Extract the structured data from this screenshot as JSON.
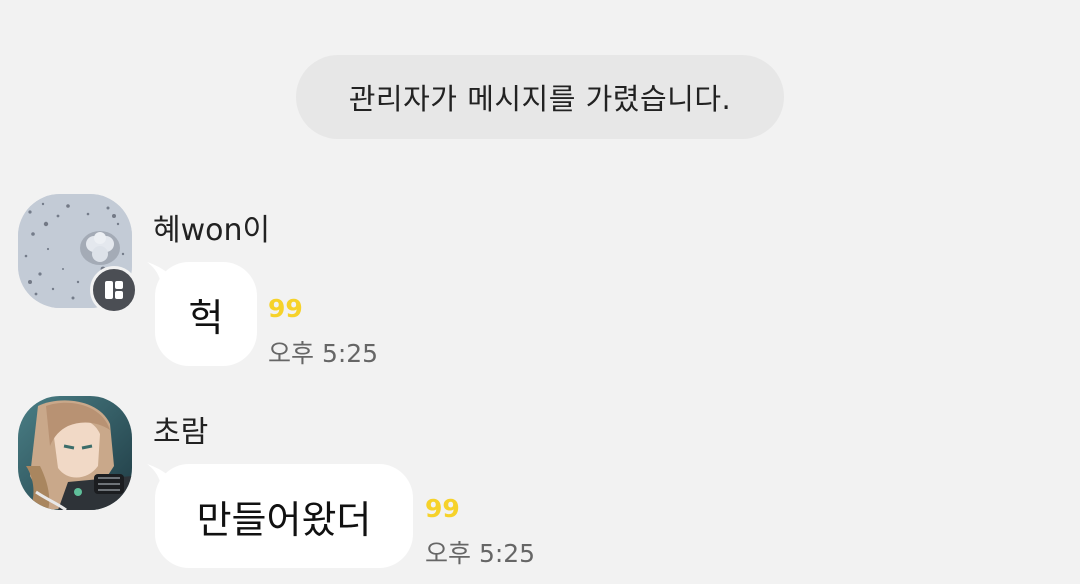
{
  "system_notice": "관리자가 메시지를 가렸습니다.",
  "messages": [
    {
      "sender": "혜won이",
      "text": "헉",
      "unread": "99",
      "time": "오후 5:25",
      "has_badge": true
    },
    {
      "sender": "초람",
      "text": "만들어왔더",
      "unread": "99",
      "time": "오후 5:25",
      "has_badge": false
    }
  ],
  "colors": {
    "background": "#f2f2f2",
    "notice_bg": "#e7e7e7",
    "bubble": "#ffffff",
    "unread": "#f6d22a",
    "time": "#666666",
    "badge": "#4b4e54"
  },
  "icons": {
    "badge_icon": "manager-badge-icon"
  }
}
